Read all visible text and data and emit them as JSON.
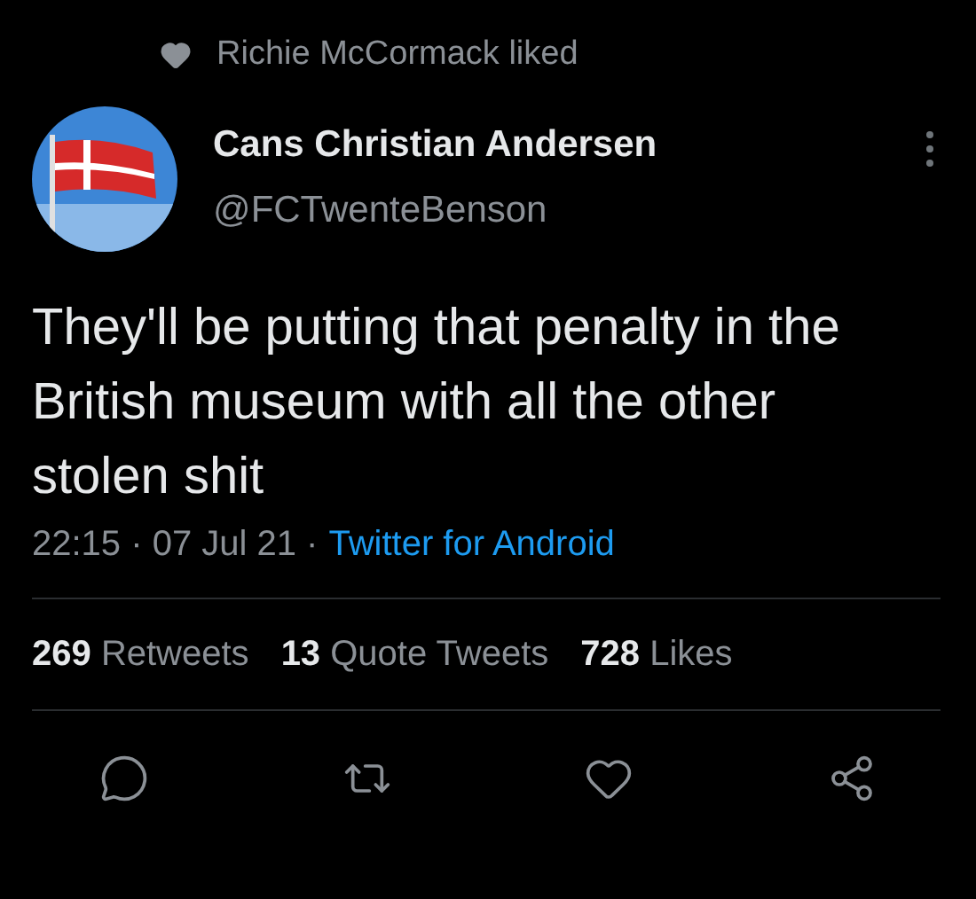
{
  "social_context": {
    "text": "Richie McCormack liked"
  },
  "author": {
    "name": "Cans Christian Andersen",
    "handle": "@FCTwenteBenson"
  },
  "tweet": {
    "text": "They'll be putting that penalty in the British museum with all the other stolen shit"
  },
  "meta": {
    "timestamp": "22:15 · 07 Jul 21 ·",
    "source": "Twitter for Android"
  },
  "stats": [
    {
      "count": "269",
      "label": "Retweets"
    },
    {
      "count": "13",
      "label": "Quote Tweets"
    },
    {
      "count": "728",
      "label": "Likes"
    }
  ],
  "actions": [
    {
      "kind": "reply"
    },
    {
      "kind": "retweet"
    },
    {
      "kind": "like"
    },
    {
      "kind": "share"
    }
  ]
}
